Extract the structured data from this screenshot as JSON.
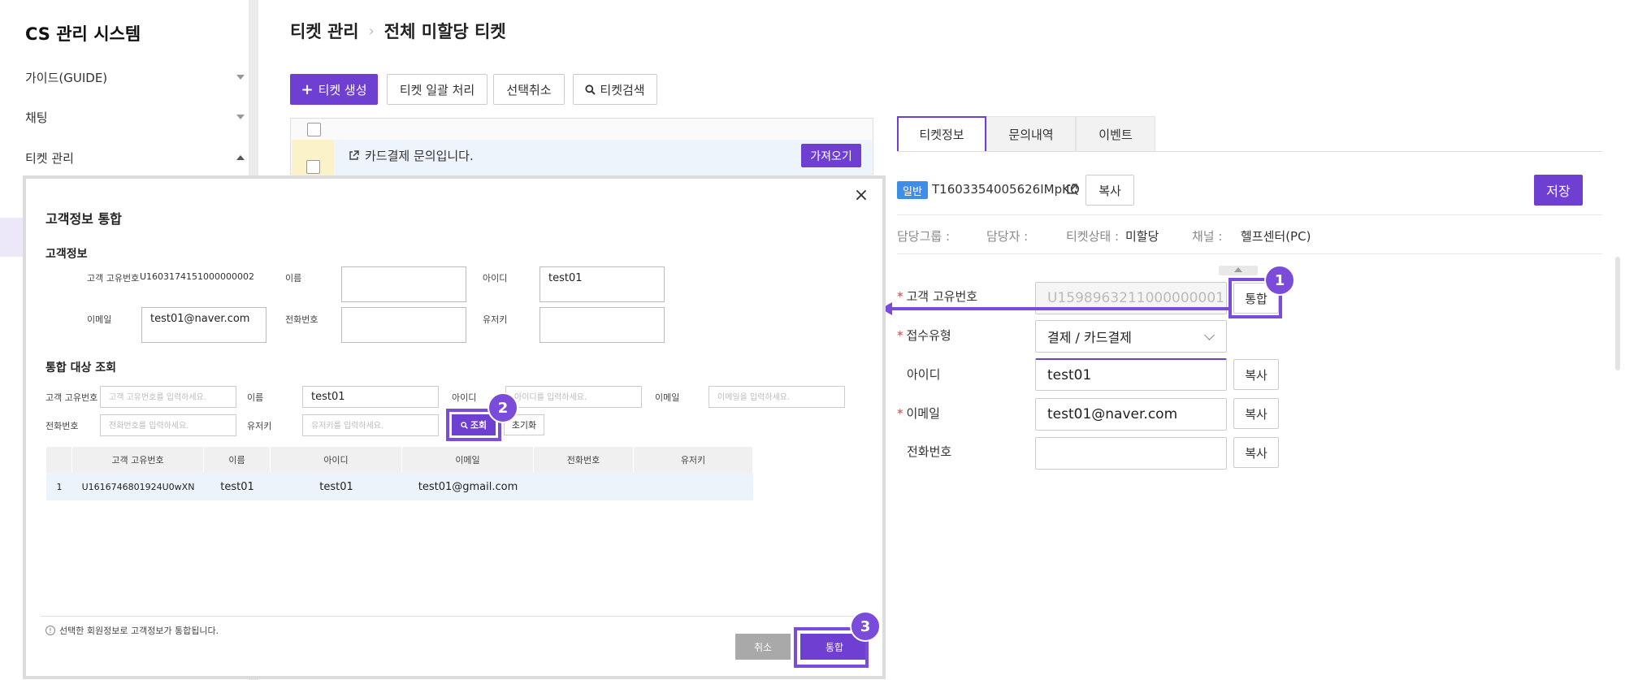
{
  "app": {
    "title": "CS 관리 시스템"
  },
  "sidebar": {
    "items": [
      {
        "label": "가이드(GUIDE)"
      },
      {
        "label": "채팅"
      },
      {
        "label": "티켓 관리"
      }
    ]
  },
  "breadcrumb": {
    "parent": "티켓 관리",
    "current": "전체 미할당 티켓"
  },
  "toolbar": {
    "create": "티켓 생성",
    "bulk": "티켓 일괄 처리",
    "deselect": "선택취소",
    "search": "티켓검색"
  },
  "ticket_list": {
    "row_title": "카드결제 문의입니다.",
    "fetch_button": "가져오기"
  },
  "detail": {
    "tabs": [
      "티켓정보",
      "문의내역",
      "이벤트"
    ],
    "badge": "일반",
    "ticket_id": "T1603354005626IMpKQ",
    "copy": "복사",
    "save": "저장",
    "meta": {
      "group_label": "담당그룹 :",
      "assignee_label": "담당자 :",
      "status_label": "티켓상태 :",
      "status_value": "미할당",
      "channel_label": "채널 :",
      "channel_value": "헬프센터(PC)"
    },
    "fields": {
      "customer_id_label": "고객 고유번호",
      "customer_id_value": "U1598963211000000001",
      "merge_button": "통합",
      "type_label": "접수유형",
      "type_value": "결제 / 카드결제",
      "userid_label": "아이디",
      "userid_value": "test01",
      "email_label": "이메일",
      "email_value": "test01@naver.com",
      "phone_label": "전화번호",
      "phone_value": ""
    }
  },
  "modal": {
    "title": "고객정보 통합",
    "close": "×",
    "customer_section": "고객정보",
    "labels": {
      "customer_id": "고객 고유번호",
      "name": "이름",
      "userid": "아이디",
      "email": "이메일",
      "phone": "전화번호",
      "userkey": "유저키"
    },
    "customer": {
      "customer_id": "U1603174151000000002",
      "name": "",
      "userid": "test01",
      "email": "test01@naver.com",
      "phone": "",
      "userkey": ""
    },
    "search_section": "통합 대상 조회",
    "search": {
      "customer_id_placeholder": "고객 고유번호를 입력하세요.",
      "name_value": "test01",
      "userid_placeholder": "아이디를 입력하세요.",
      "email_placeholder": "이메일을 입력하세요.",
      "phone_placeholder": "전화번호를 입력하세요.",
      "userkey_placeholder": "유저키를 입력하세요.",
      "search_button": "조회",
      "reset_button": "초기화"
    },
    "table": {
      "headers": [
        "고객 고유번호",
        "이름",
        "아이디",
        "이메일",
        "전화번호",
        "유저키"
      ],
      "rows": [
        {
          "no": "1",
          "customer_id": "U1616746801924U0wXN",
          "name": "test01",
          "userid": "test01",
          "email": "test01@gmail.com",
          "phone": "",
          "userkey": ""
        }
      ]
    },
    "notice": "선택한 회원정보로 고객정보가 통합됩니다.",
    "cancel": "취소",
    "merge": "통합"
  },
  "annotations": {
    "step1": "1",
    "step2": "2",
    "step3": "3"
  },
  "colors": {
    "accent": "#6e3fd1",
    "badge": "#3d8ee9",
    "required": "#e03b3b"
  }
}
